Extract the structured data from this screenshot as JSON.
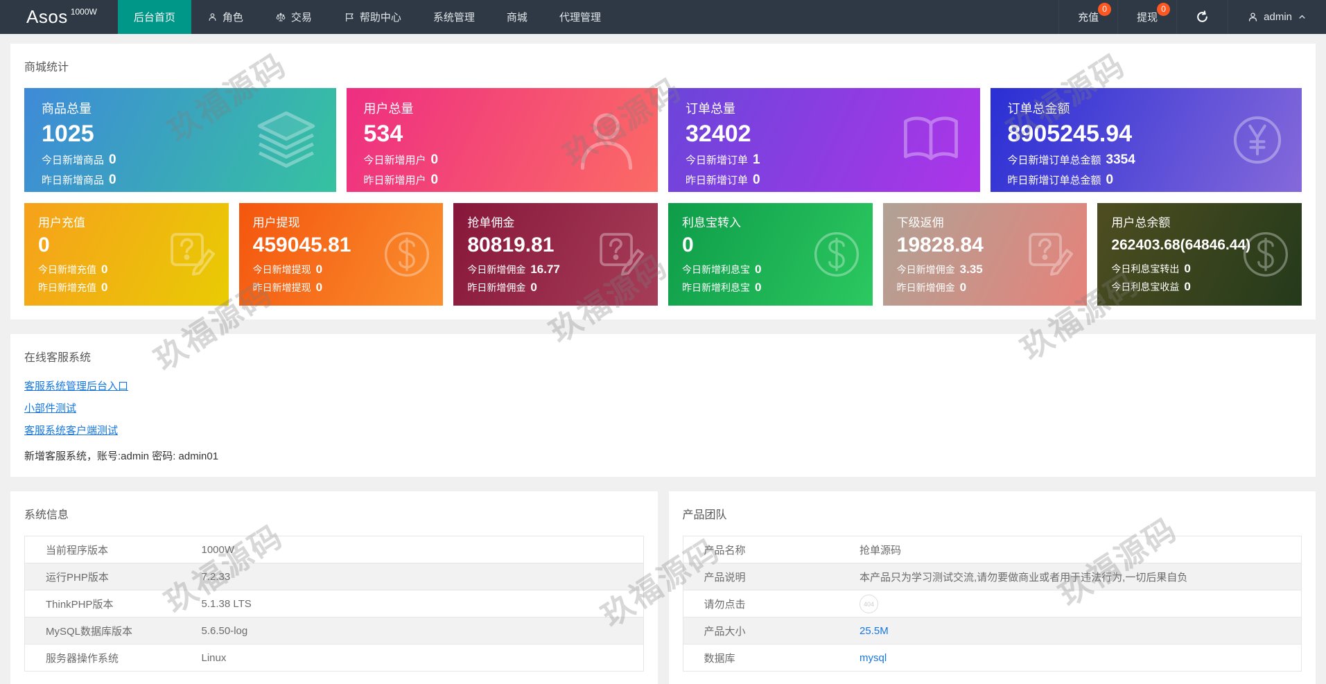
{
  "colors": {
    "accent": "#009688",
    "badge": "#ff5722",
    "link": "#1677e0",
    "navbar_bg": "#2e3945"
  },
  "watermark": "玖福源码",
  "navbar": {
    "logo": "Asos",
    "logo_sup": "1000W",
    "menu": [
      {
        "id": "home",
        "label": "后台首页",
        "active": true
      },
      {
        "id": "roles",
        "label": "角色",
        "icon": "user-icon"
      },
      {
        "id": "trade",
        "label": "交易",
        "icon": "scales-icon"
      },
      {
        "id": "help-center",
        "label": "帮助中心",
        "icon": "flag-icon"
      },
      {
        "id": "system-manage",
        "label": "系统管理"
      },
      {
        "id": "mall",
        "label": "商城"
      },
      {
        "id": "agent-manage",
        "label": "代理管理"
      }
    ],
    "actions": [
      {
        "id": "recharge",
        "label": "充值",
        "badge": "0"
      },
      {
        "id": "withdraw",
        "label": "提现",
        "badge": "0"
      }
    ],
    "user": "admin"
  },
  "stats": {
    "title": "商城统计",
    "row1": [
      {
        "id": "goods-total",
        "label": "商品总量",
        "value": "1025",
        "icon": "layers-icon",
        "gradient": [
          "#3e8ad8",
          "#36c2a0"
        ],
        "lines": [
          {
            "label": "今日新增商品",
            "value": "0"
          },
          {
            "label": "昨日新增商品",
            "value": "0"
          }
        ]
      },
      {
        "id": "users-total",
        "label": "用户总量",
        "value": "534",
        "icon": "person-icon",
        "gradient": [
          "#ee2e82",
          "#fb6b65"
        ],
        "lines": [
          {
            "label": "今日新增用户",
            "value": "0"
          },
          {
            "label": "昨日新增用户",
            "value": "0"
          }
        ]
      },
      {
        "id": "orders-total",
        "label": "订单总量",
        "value": "32402",
        "icon": "book-icon",
        "gradient": [
          "#6b45da",
          "#ad35e9"
        ],
        "lines": [
          {
            "label": "今日新增订单",
            "value": "1"
          },
          {
            "label": "昨日新增订单",
            "value": "0"
          }
        ]
      },
      {
        "id": "orders-amount",
        "label": "订单总金额",
        "value": "8905245.94",
        "icon": "yen-circle-icon",
        "gradient": [
          "#2a2fd4",
          "#8569da"
        ],
        "lines": [
          {
            "label": "今日新增订单总金额",
            "value": "3354"
          },
          {
            "label": "昨日新增订单总金额",
            "value": "0"
          }
        ]
      }
    ],
    "row2": [
      {
        "id": "user-recharge",
        "label": "用户充值",
        "value": "0",
        "icon": "question-edit-icon",
        "gradient": [
          "#f6a11b",
          "#e9cb04"
        ],
        "lines": [
          {
            "label": "今日新增充值",
            "value": "0"
          },
          {
            "label": "昨日新增充值",
            "value": "0"
          }
        ]
      },
      {
        "id": "user-withdraw",
        "label": "用户提现",
        "value": "459045.81",
        "icon": "dollar-circle-icon",
        "gradient": [
          "#f4560e",
          "#fa8f2e"
        ],
        "lines": [
          {
            "label": "今日新增提现",
            "value": "0"
          },
          {
            "label": "昨日新增提现",
            "value": "0"
          }
        ]
      },
      {
        "id": "order-commission",
        "label": "抢单佣金",
        "value": "80819.81",
        "icon": "question-edit-icon",
        "gradient": [
          "#87173a",
          "#a63d58"
        ],
        "lines": [
          {
            "label": "今日新增佣金",
            "value": "16.77"
          },
          {
            "label": "昨日新增佣金",
            "value": "0"
          }
        ]
      },
      {
        "id": "interest-in",
        "label": "利息宝转入",
        "value": "0",
        "icon": "dollar-circle-icon",
        "gradient": [
          "#0e9c49",
          "#2cc860"
        ],
        "lines": [
          {
            "label": "今日新增利息宝",
            "value": "0"
          },
          {
            "label": "昨日新增利息宝",
            "value": "0"
          }
        ]
      },
      {
        "id": "sub-rebate",
        "label": "下级返佣",
        "value": "19828.84",
        "icon": "question-edit-icon",
        "gradient": [
          "#b0a295",
          "#e6827a"
        ],
        "lines": [
          {
            "label": "今日新增佣金",
            "value": "3.35"
          },
          {
            "label": "昨日新增佣金",
            "value": "0"
          }
        ]
      },
      {
        "id": "user-balance",
        "label": "用户总余额",
        "value": "262403.68(64846.44)",
        "icon": "dollar-circle-icon",
        "gradient": [
          "#4e4d20",
          "#243a1b"
        ],
        "lines": [
          {
            "label": "今日利息宝转出",
            "value": "0"
          },
          {
            "label": "今日利息宝收益",
            "value": "0"
          }
        ]
      }
    ]
  },
  "service": {
    "title": "在线客服系统",
    "links": [
      {
        "id": "admin-entry",
        "label": "客服系统管理后台入口"
      },
      {
        "id": "widget-test",
        "label": "小部件测试"
      },
      {
        "id": "client-test",
        "label": "客服系统客户端测试"
      }
    ],
    "note": "新增客服系统，账号:admin 密码: admin01"
  },
  "system_info": {
    "title": "系统信息",
    "rows": [
      {
        "label": "当前程序版本",
        "value": "1000W",
        "type": "text"
      },
      {
        "label": "运行PHP版本",
        "value": "7.2.33",
        "type": "text"
      },
      {
        "label": "ThinkPHP版本",
        "value": "5.1.38 LTS",
        "type": "text"
      },
      {
        "label": "MySQL数据库版本",
        "value": "5.6.50-log",
        "type": "text"
      },
      {
        "label": "服务器操作系统",
        "value": "Linux",
        "type": "text"
      }
    ]
  },
  "product_team": {
    "title": "产品团队",
    "rows": [
      {
        "label": "产品名称",
        "value": "抢单源码",
        "type": "text"
      },
      {
        "label": "产品说明",
        "value": "本产品只为学习测试交流,请勿要做商业或者用于违法行为,一切后果自负",
        "type": "text"
      },
      {
        "label": "请勿点击",
        "value": "404",
        "type": "icon"
      },
      {
        "label": "产品大小",
        "value": "25.5M",
        "type": "link"
      },
      {
        "label": "数据库",
        "value": "mysql",
        "type": "link"
      }
    ]
  }
}
